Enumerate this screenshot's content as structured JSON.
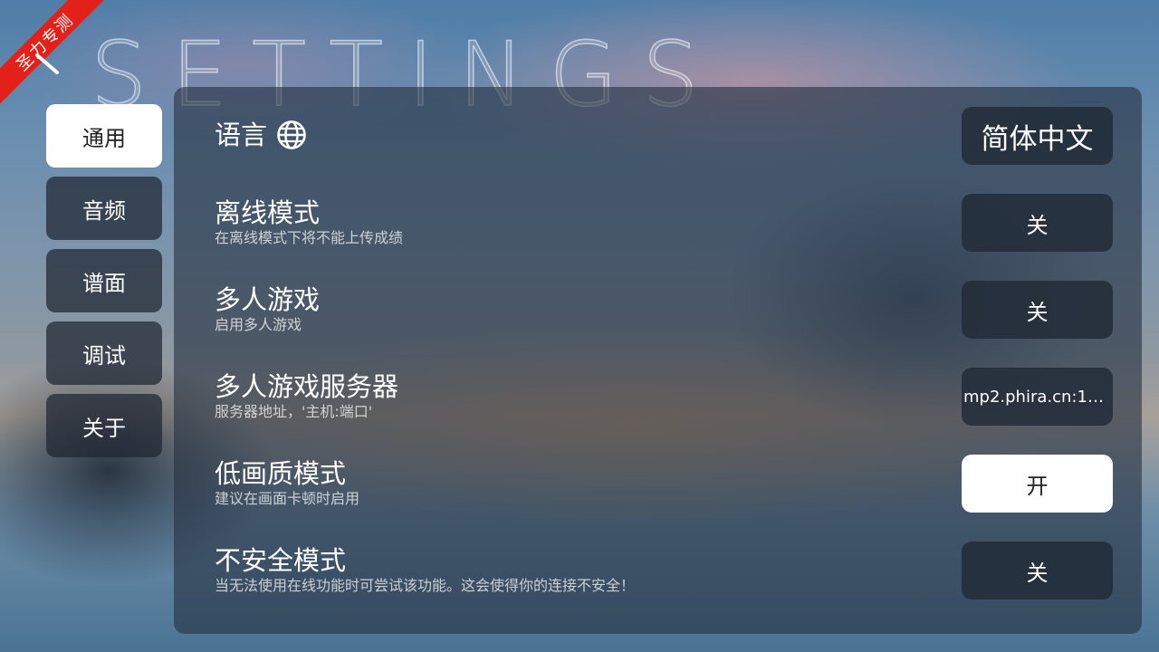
{
  "page": {
    "title": "SETTINGS"
  },
  "ribbon": {
    "text": "圣力专测"
  },
  "sidebar": {
    "tabs": [
      {
        "label": "通用",
        "active": true
      },
      {
        "label": "音频",
        "active": false
      },
      {
        "label": "谱面",
        "active": false
      },
      {
        "label": "调试",
        "active": false
      },
      {
        "label": "关于",
        "active": false
      }
    ]
  },
  "settings": {
    "language": {
      "title": "语言",
      "icon": "globe-icon",
      "value": "简体中文"
    },
    "offline": {
      "title": "离线模式",
      "desc": "在离线模式下将不能上传成绩",
      "value": "关"
    },
    "multiplayer": {
      "title": "多人游戏",
      "desc": "启用多人游戏",
      "value": "关"
    },
    "server": {
      "title": "多人游戏服务器",
      "desc": "服务器地址，'主机:端口'",
      "value": "mp2.phira.cn:1…"
    },
    "low_quality": {
      "title": "低画质模式",
      "desc": "建议在画面卡顿时启用",
      "value": "开"
    },
    "unsafe": {
      "title": "不安全模式",
      "desc": "当无法使用在线功能时可尝试该功能。这会使得你的连接不安全！",
      "value": "关"
    }
  },
  "colors": {
    "ribbon": "#e3201a",
    "active_bg": "#ffffff",
    "panel_bg": "#26324288"
  }
}
